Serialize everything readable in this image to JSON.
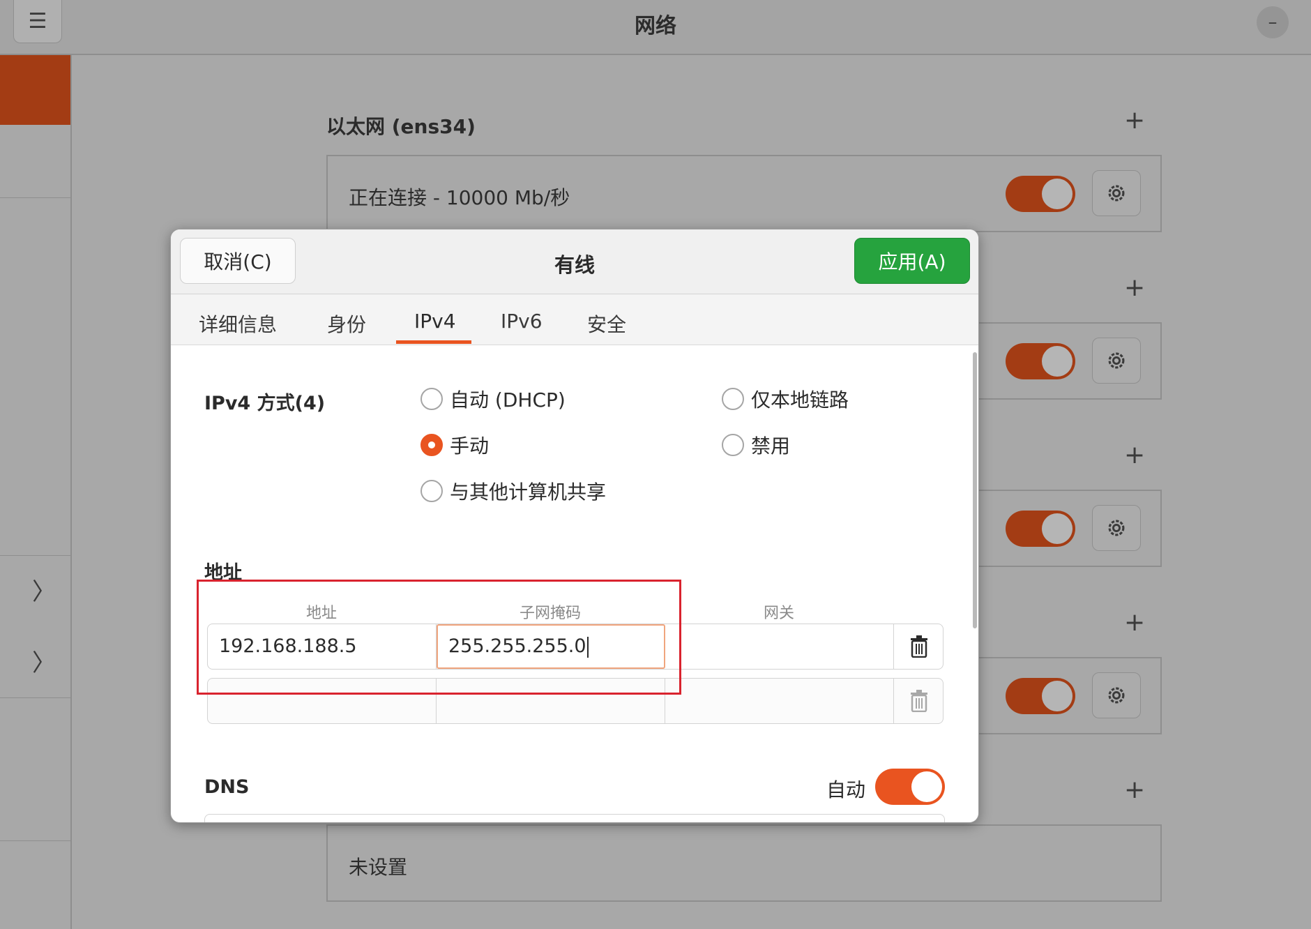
{
  "window": {
    "title": "网络",
    "menu_icon": "☰",
    "minimize_icon": "–"
  },
  "background": {
    "section_head": "以太网 (ens34)",
    "plus": "+",
    "card_status": "正在连接 - 10000 Mb/秒",
    "card_bottom": "未设置"
  },
  "sidebar": {
    "chevron": "〉"
  },
  "dialog": {
    "title": "有线",
    "cancel_label": "取消(C)",
    "apply_label": "应用(A)",
    "tabs": [
      "详细信息",
      "身份",
      "IPv4",
      "IPv6",
      "安全"
    ],
    "active_tab": "IPv4",
    "ipv4_method_label": "IPv4 方式(4)",
    "methods": {
      "auto": "自动 (DHCP)",
      "manual": "手动",
      "shared": "与其他计算机共享",
      "link_local": "仅本地链路",
      "disabled": "禁用"
    },
    "selected_method": "manual",
    "address_section_label": "地址",
    "columns": {
      "address": "地址",
      "netmask": "子网掩码",
      "gateway": "网关"
    },
    "rows": [
      {
        "address": "192.168.188.5",
        "netmask": "255.255.255.0",
        "gateway": ""
      },
      {
        "address": "",
        "netmask": "",
        "gateway": ""
      }
    ],
    "dns_label": "DNS",
    "dns_auto_label": "自动",
    "dns_auto_on": true
  },
  "colors": {
    "accent": "#e95420",
    "apply_green": "#26a33e",
    "highlight_red": "#d9232e"
  }
}
